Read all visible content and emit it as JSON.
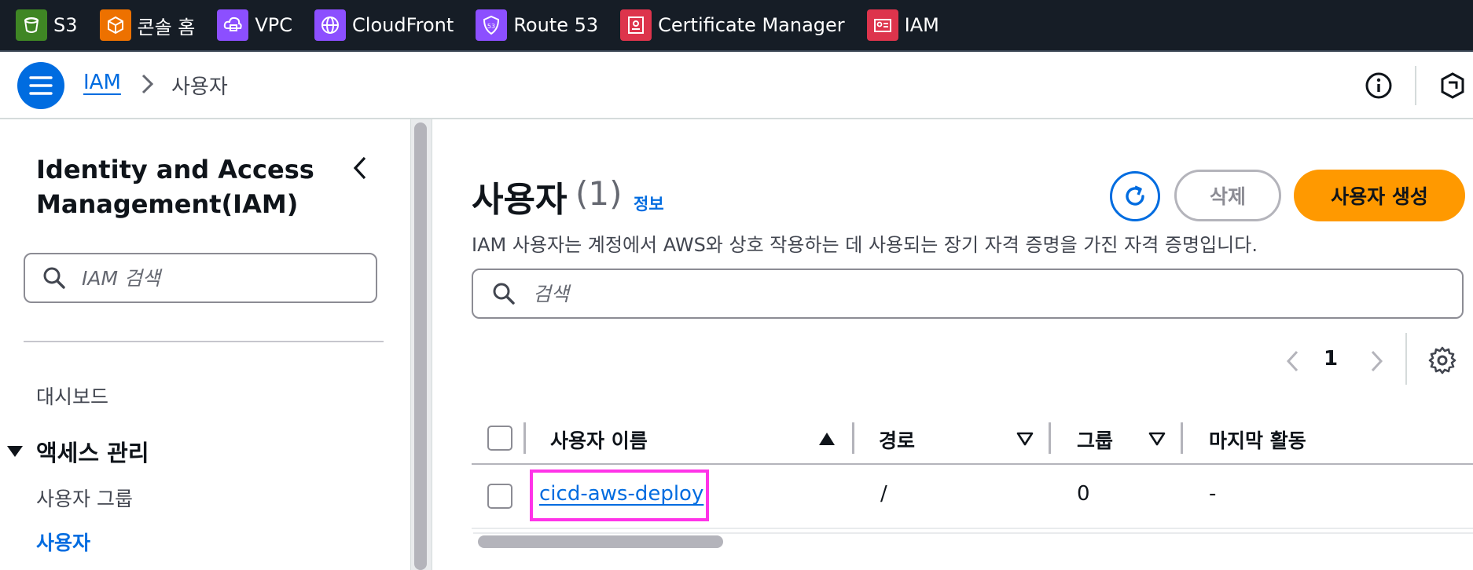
{
  "favorites": [
    {
      "label": "S3",
      "icon": "s3-icon",
      "color": "#3f8624"
    },
    {
      "label": "콘솔 홈",
      "icon": "console-home-icon",
      "color": "#ed7100"
    },
    {
      "label": "VPC",
      "icon": "vpc-icon",
      "color": "#8c4fff"
    },
    {
      "label": "CloudFront",
      "icon": "cloudfront-icon",
      "color": "#8c4fff"
    },
    {
      "label": "Route 53",
      "icon": "route53-icon",
      "color": "#8c4fff"
    },
    {
      "label": "Certificate Manager",
      "icon": "certificate-manager-icon",
      "color": "#dd344c"
    },
    {
      "label": "IAM",
      "icon": "iam-icon",
      "color": "#dd344c"
    }
  ],
  "header": {
    "breadcrumb_root": "IAM",
    "breadcrumb_current": "사용자"
  },
  "sidebar": {
    "title": "Identity and Access Management(IAM)",
    "search_placeholder": "IAM 검색",
    "dashboard": "대시보드",
    "section": "액세스 관리",
    "items": [
      "사용자 그룹",
      "사용자"
    ]
  },
  "main": {
    "title": "사용자",
    "count": "(1)",
    "info_link": "정보",
    "delete_label": "삭제",
    "create_label": "사용자 생성",
    "description": "IAM 사용자는 계정에서 AWS와 상호 작용하는 데 사용되는 장기 자격 증명을 가진 자격 증명입니다.",
    "search_placeholder": "검색",
    "page_number": "1"
  },
  "table": {
    "columns": [
      "사용자 이름",
      "경로",
      "그룹",
      "마지막 활동"
    ],
    "rows": [
      {
        "user_name": "cicd-aws-deploy",
        "path": "/",
        "groups": "0",
        "last_activity": "-"
      }
    ]
  },
  "colors": {
    "accent": "#006ce0",
    "primary_button": "#ff9900",
    "highlight": "#ff33e8",
    "favbar_bg": "#161d26"
  }
}
